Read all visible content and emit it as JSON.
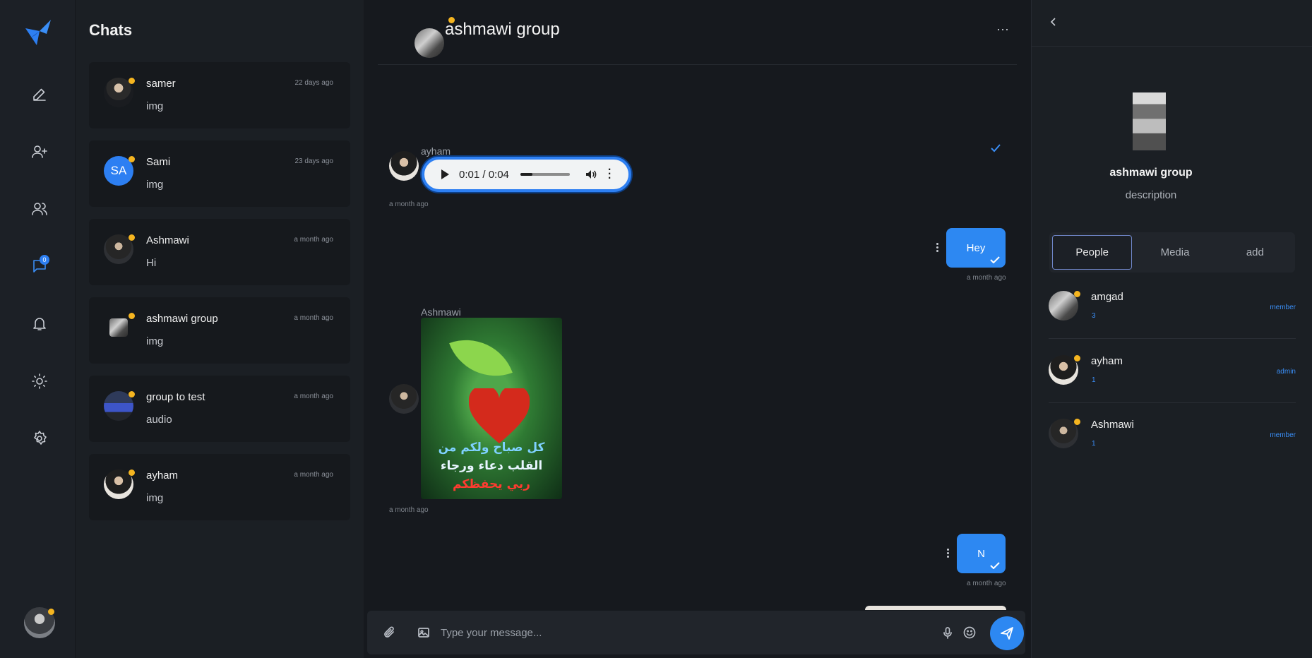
{
  "nav": {
    "unread_count": "0",
    "items": [
      "compose",
      "add-user",
      "contacts",
      "chats",
      "notifications",
      "theme",
      "settings"
    ]
  },
  "chat_list": {
    "title": "Chats",
    "items": [
      {
        "name": "samer",
        "time": "22 days ago",
        "preview": "img",
        "avatar": "photo"
      },
      {
        "name": "Sami",
        "time": "23 days ago",
        "preview": "img",
        "avatar": "SA"
      },
      {
        "name": "Ashmawi",
        "time": "a month ago",
        "preview": "Hi",
        "avatar": "photo"
      },
      {
        "name": "ashmawi group",
        "time": "a month ago",
        "preview": "img",
        "avatar": "photo"
      },
      {
        "name": "group to test",
        "time": "a month ago",
        "preview": "audio",
        "avatar": "photo"
      },
      {
        "name": "ayham",
        "time": "a month ago",
        "preview": "img",
        "avatar": "photo"
      }
    ]
  },
  "conversation": {
    "title": "ashmawi group",
    "messages": [
      {
        "sender": "ayham",
        "type": "audio",
        "audio_time": "0:01 / 0:04",
        "progress": 0.25,
        "stamp": "a month ago"
      },
      {
        "sender": "me",
        "type": "text",
        "text": "Hey",
        "stamp": "a month ago"
      },
      {
        "sender": "Ashmawi",
        "type": "image",
        "image_lines": [
          "كل صباح ولكم من",
          "القلب دعاء ورجاء",
          "ربي يحفظكم"
        ],
        "stamp": "a month ago"
      },
      {
        "sender": "me",
        "type": "text",
        "text": "N",
        "stamp": "a month ago"
      }
    ],
    "composer_placeholder": "Type your message..."
  },
  "info_panel": {
    "group_name": "ashmawi group",
    "description": "description",
    "tabs": [
      "People",
      "Media",
      "add"
    ],
    "active_tab": "People",
    "members": [
      {
        "name": "amgad",
        "count": "3",
        "role": "member"
      },
      {
        "name": "ayham",
        "count": "1",
        "role": "admin"
      },
      {
        "name": "Ashmawi",
        "count": "1",
        "role": "member"
      }
    ]
  },
  "colors": {
    "accent": "#2d88f2",
    "online_dot": "#f5b520",
    "background": "#16191e",
    "panel": "#1b1f24"
  }
}
